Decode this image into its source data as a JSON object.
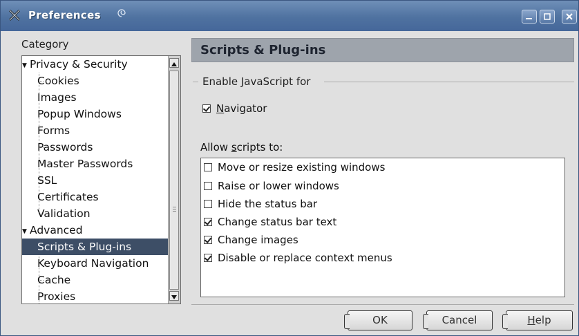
{
  "window": {
    "title": "Preferences"
  },
  "sidebar": {
    "category_label": "Category",
    "items": [
      {
        "label": "Privacy & Security",
        "expanded": true,
        "level": 0
      },
      {
        "label": "Cookies",
        "level": 1
      },
      {
        "label": "Images",
        "level": 1
      },
      {
        "label": "Popup Windows",
        "level": 1
      },
      {
        "label": "Forms",
        "level": 1
      },
      {
        "label": "Passwords",
        "level": 1
      },
      {
        "label": "Master Passwords",
        "level": 1
      },
      {
        "label": "SSL",
        "level": 1
      },
      {
        "label": "Certificates",
        "level": 1
      },
      {
        "label": "Validation",
        "level": 1
      },
      {
        "label": "Advanced",
        "expanded": true,
        "level": 0
      },
      {
        "label": "Scripts & Plug-ins",
        "level": 1,
        "selected": true
      },
      {
        "label": "Keyboard Navigation",
        "level": 1
      },
      {
        "label": "Cache",
        "level": 1
      },
      {
        "label": "Proxies",
        "level": 1
      }
    ]
  },
  "main": {
    "header_title": "Scripts & Plug-ins",
    "enable_js": {
      "group_title": "Enable JavaScript for",
      "navigator_prefix": "",
      "navigator_mnemonic": "N",
      "navigator_rest": "avigator",
      "navigator_checked": true
    },
    "allow_label_prefix": "Allow ",
    "allow_label_mnemonic": "s",
    "allow_label_rest": "cripts to:",
    "scripts": [
      {
        "label": "Move or resize existing windows",
        "checked": false
      },
      {
        "label": "Raise or lower windows",
        "checked": false
      },
      {
        "label": "Hide the status bar",
        "checked": false
      },
      {
        "label": "Change status bar text",
        "checked": true
      },
      {
        "label": "Change images",
        "checked": true
      },
      {
        "label": "Disable or replace context menus",
        "checked": true
      }
    ]
  },
  "buttons": {
    "ok": "OK",
    "cancel": "Cancel",
    "help_mnemonic": "H",
    "help_rest": "elp"
  },
  "colors": {
    "titlebar": "#4f72a0",
    "selection": "#3d4e66",
    "header_band": "#9ea4ac"
  },
  "icons": {
    "title_icon": "x-cross-icon",
    "title_swirl": "swirl-icon",
    "minimize": "minimize-icon",
    "maximize": "maximize-icon",
    "close": "close-icon"
  }
}
